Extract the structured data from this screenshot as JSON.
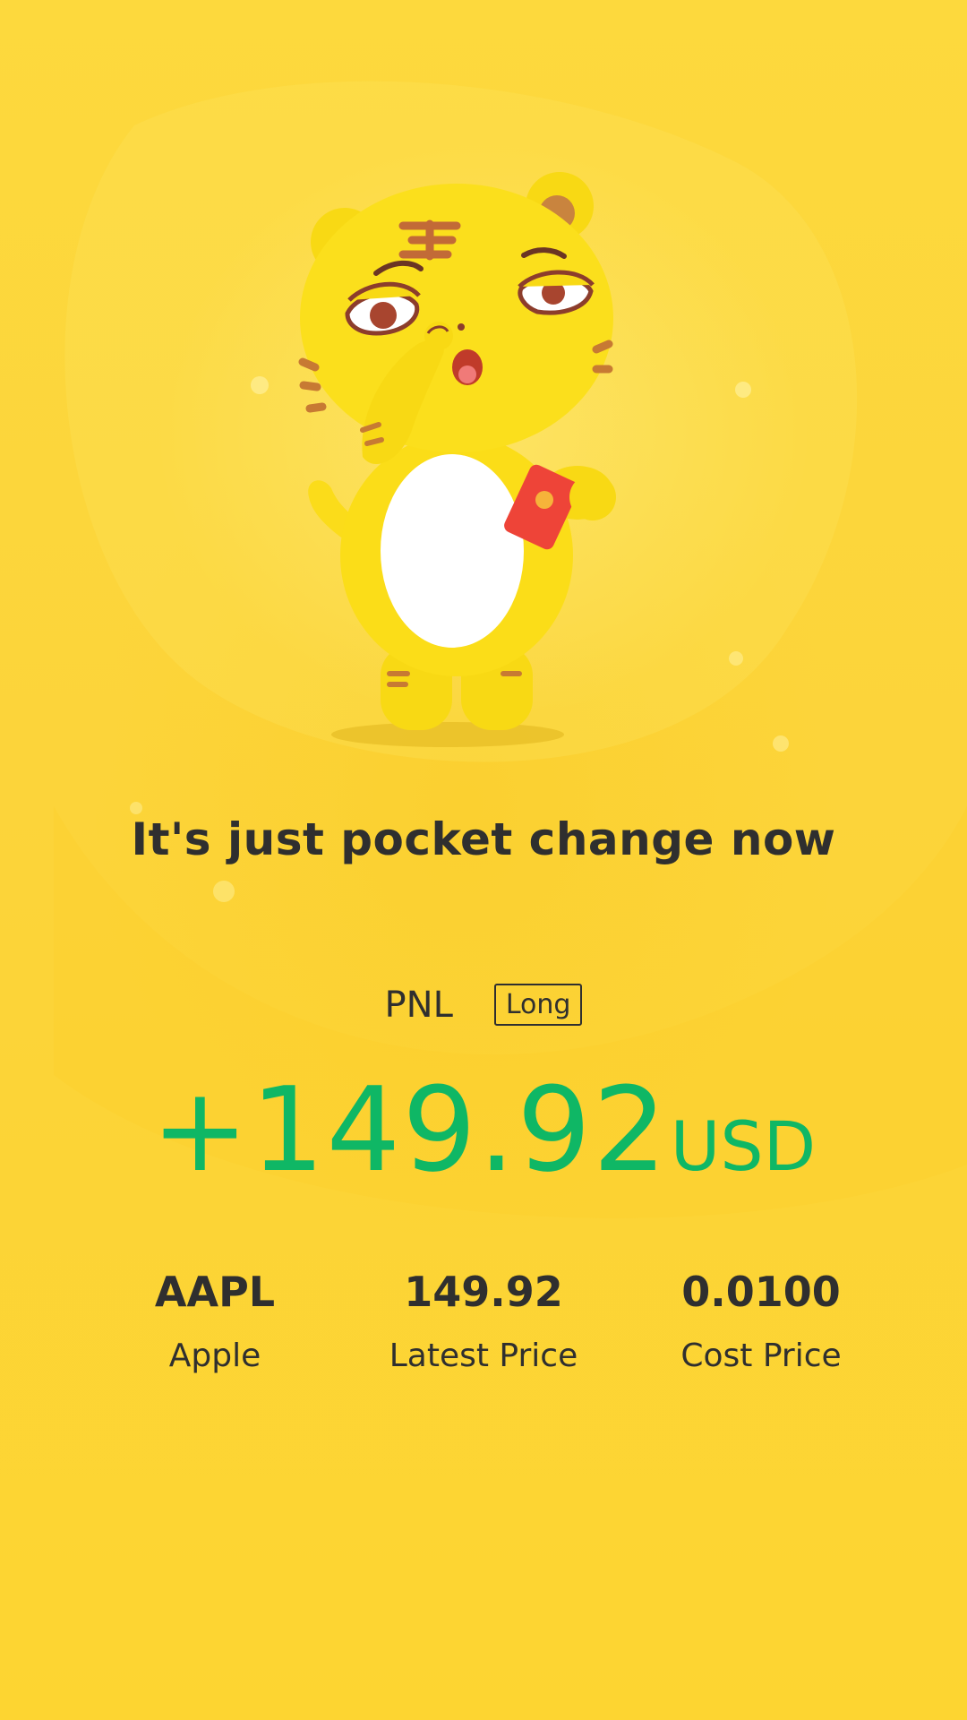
{
  "colors": {
    "background": "#fcd43a",
    "text": "#2f2f2f",
    "profit": "#0fb765"
  },
  "mascot": {
    "icon": "tiger-mascot-icon",
    "accessory_icon": "red-envelope-icon"
  },
  "headline": "It's just pocket change now",
  "pnl": {
    "label": "PNL",
    "direction": "Long",
    "amount": "+149.92",
    "currency": "USD"
  },
  "stats": [
    {
      "value": "AAPL",
      "label": "Apple"
    },
    {
      "value": "149.92",
      "label": "Latest Price"
    },
    {
      "value": "0.0100",
      "label": "Cost Price"
    }
  ]
}
